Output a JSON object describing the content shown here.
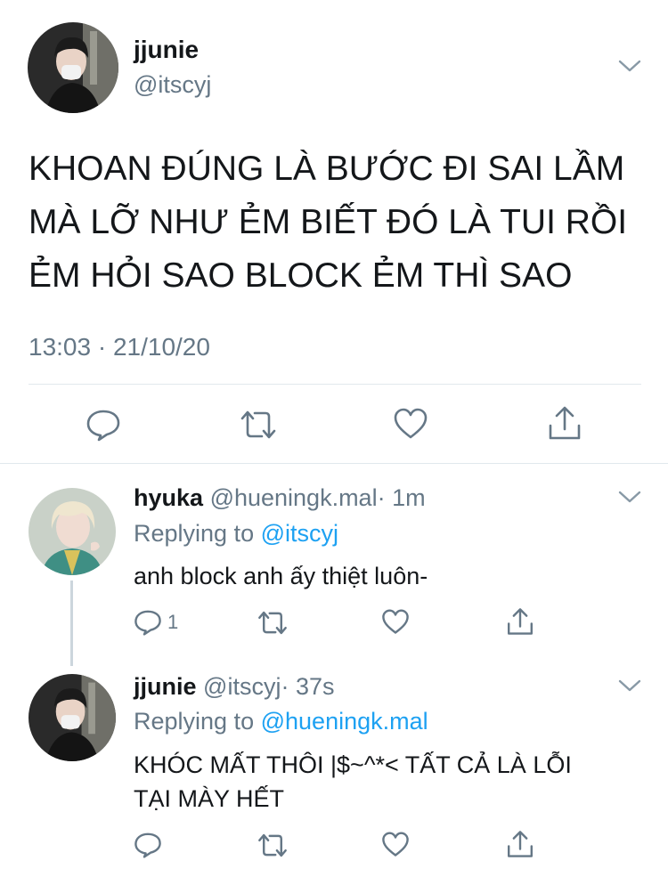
{
  "main_tweet": {
    "author_name": "jjunie",
    "author_handle": "@itscyj",
    "text_lines": [
      "KHOAN ĐÚNG LÀ BƯỚC ĐI SAI LẦM",
      "MÀ LỠ NHƯ ẺM BIẾT ĐÓ LÀ TUI RỒI",
      "ẺM HỎI SAO BLOCK ẺM THÌ SAO"
    ],
    "timestamp": "13:03 · 21/10/20"
  },
  "replies": [
    {
      "author_name": "hyuka",
      "author_handle": "@hueningk.mal",
      "time": "· 1m",
      "replying_label": "Replying to",
      "replying_to": "@itscyj",
      "text_lines": [
        "anh block anh ấy thiệt luôn-"
      ],
      "reply_count": "1"
    },
    {
      "author_name": "jjunie",
      "author_handle": "@itscyj",
      "time": "· 37s",
      "replying_label": "Replying to",
      "replying_to": "@hueningk.mal",
      "text_lines": [
        "KHÓC MẤT THÔI |$~^*< TẤT CẢ LÀ LỖI",
        "TẠI MÀY HẾT"
      ]
    }
  ],
  "icons": {
    "reply": "speech-bubble-icon",
    "retweet": "retweet-icon",
    "like": "heart-icon",
    "share": "share-icon",
    "more": "chevron-down-icon"
  },
  "colors": {
    "text": "#14171a",
    "secondary": "#657786",
    "link": "#1da1f2",
    "divider": "#e1e8ed"
  }
}
